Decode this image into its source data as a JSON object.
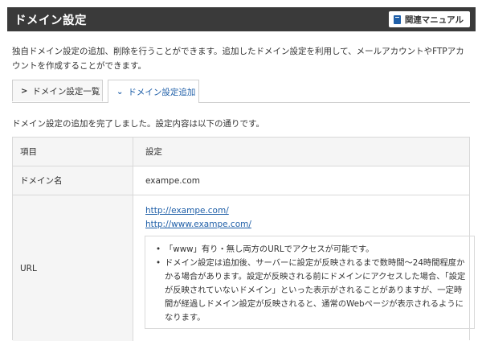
{
  "header": {
    "title": "ドメイン設定",
    "manual_label": "関連マニュアル",
    "manual_icon": "book-icon"
  },
  "description": "独自ドメイン設定の追加、削除を行うことができます。追加したドメイン設定を利用して、メールアカウントやFTPアカウントを作成することができます。",
  "tabs": [
    {
      "label": "ドメイン設定一覧",
      "active": false
    },
    {
      "label": "ドメイン設定追加",
      "active": true
    }
  ],
  "message": "ドメイン設定の追加を完了しました。設定内容は以下の通りです。",
  "table": {
    "header": {
      "item": "項目",
      "setting": "設定"
    },
    "domain": {
      "label": "ドメイン名",
      "value": "exampe.com"
    },
    "url": {
      "label": "URL",
      "links": [
        "http://exampe.com/",
        "http://www.exampe.com/"
      ],
      "notes": [
        "「www」有り・無し両方のURLでアクセスが可能です。",
        "ドメイン設定は追加後、サーバーに設定が反映されるまで数時間〜24時間程度かかる場合があります。設定が反映される前にドメインにアクセスした場合、「設定が反映されていないドメイン」といった表示がされることがありますが、一定時間が経過しドメイン設定が反映されると、通常のWebページが表示されるようになります。"
      ]
    }
  },
  "colors": {
    "header_bg": "#3a3a3a",
    "accent": "#1f5fa8",
    "table_head_bg": "#f5f5f5",
    "border": "#d9d9d9"
  }
}
